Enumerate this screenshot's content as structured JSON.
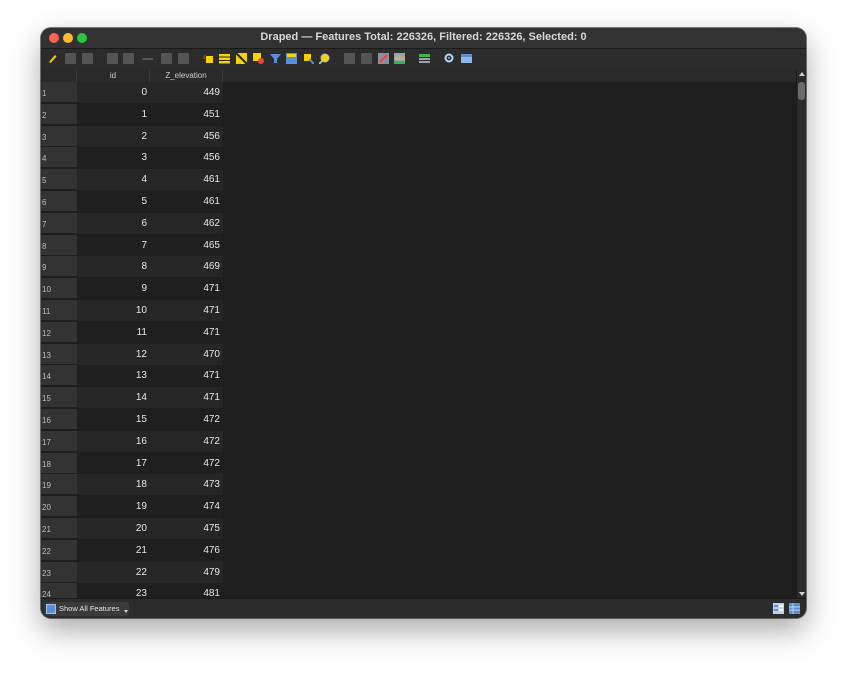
{
  "window": {
    "title": "Draped — Features Total: 226326, Filtered: 226326, Selected: 0"
  },
  "toolbar": {
    "icons": [
      "toggle-editing-icon",
      "multi-edit-icon",
      "save-edits-icon",
      "reload-icon",
      "add-feature-icon",
      "delete-feature-icon",
      "cut-icon",
      "copy-icon",
      "paste-icon",
      "select-by-expression-icon",
      "select-all-icon",
      "invert-selection-icon",
      "deselect-all-icon",
      "filter-selected-icon",
      "move-selection-to-top-icon",
      "pan-to-selected-icon",
      "zoom-to-selected-icon",
      "new-field-icon",
      "delete-field-icon",
      "field-calculator-icon",
      "conditional-formatting-icon",
      "actions-icon",
      "dock-table-icon",
      "organize-columns-icon"
    ]
  },
  "table": {
    "columns": [
      "id",
      "Z_elevation"
    ],
    "rows": [
      {
        "num": "1",
        "id": "0",
        "z": "449"
      },
      {
        "num": "2",
        "id": "1",
        "z": "451"
      },
      {
        "num": "3",
        "id": "2",
        "z": "456"
      },
      {
        "num": "4",
        "id": "3",
        "z": "456"
      },
      {
        "num": "5",
        "id": "4",
        "z": "461"
      },
      {
        "num": "6",
        "id": "5",
        "z": "461"
      },
      {
        "num": "7",
        "id": "6",
        "z": "462"
      },
      {
        "num": "8",
        "id": "7",
        "z": "465"
      },
      {
        "num": "9",
        "id": "8",
        "z": "469"
      },
      {
        "num": "10",
        "id": "9",
        "z": "471"
      },
      {
        "num": "11",
        "id": "10",
        "z": "471"
      },
      {
        "num": "12",
        "id": "11",
        "z": "471"
      },
      {
        "num": "13",
        "id": "12",
        "z": "470"
      },
      {
        "num": "14",
        "id": "13",
        "z": "471"
      },
      {
        "num": "15",
        "id": "14",
        "z": "471"
      },
      {
        "num": "16",
        "id": "15",
        "z": "472"
      },
      {
        "num": "17",
        "id": "16",
        "z": "472"
      },
      {
        "num": "18",
        "id": "17",
        "z": "472"
      },
      {
        "num": "19",
        "id": "18",
        "z": "473"
      },
      {
        "num": "20",
        "id": "19",
        "z": "474"
      },
      {
        "num": "21",
        "id": "20",
        "z": "475"
      },
      {
        "num": "22",
        "id": "21",
        "z": "476"
      },
      {
        "num": "23",
        "id": "22",
        "z": "479"
      },
      {
        "num": "24",
        "id": "23",
        "z": "481"
      }
    ]
  },
  "bottom": {
    "filter_label": "Show All Features"
  },
  "colors": {
    "accent_yellow": "#f5d300",
    "accent_blue": "#5b8fd1",
    "background": "#1e1e1e"
  }
}
